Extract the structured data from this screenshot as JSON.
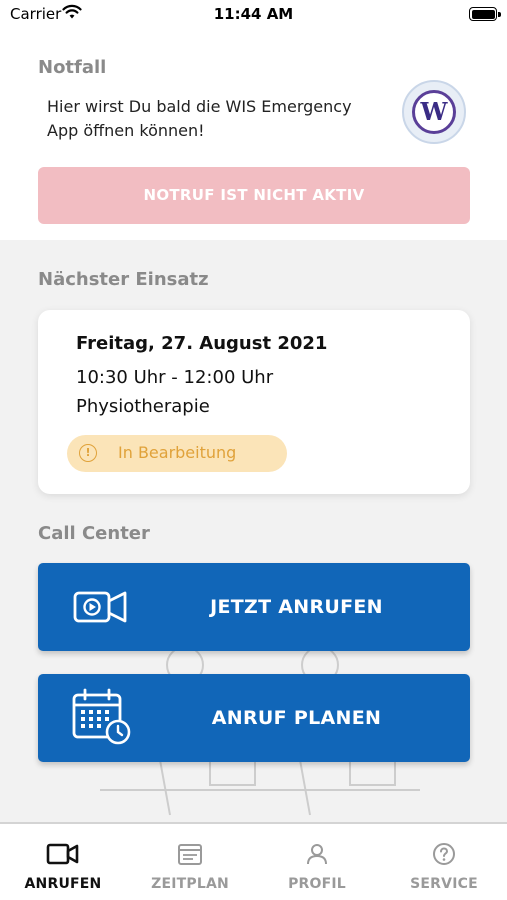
{
  "status_bar": {
    "carrier": "Carrier",
    "time": "11:44 AM",
    "battery_level": 1.0
  },
  "notfall": {
    "title": "Notfall",
    "text": "Hier wirst Du bald die WIS Emergency App öffnen können!",
    "logo_icon": "wis-emergency-logo",
    "notruf_label": "NOTRUF IST NICHT AKTIV"
  },
  "einsatz": {
    "title": "Nächster Einsatz",
    "date": "Freitag, 27. August 2021",
    "time": "10:30 Uhr - 12:00 Uhr",
    "type": "Physiotherapie",
    "status": "In Bearbeitung"
  },
  "callcenter": {
    "title": "Call Center",
    "call_now_label": "JETZT ANRUFEN",
    "call_now_icon": "video-camera-icon",
    "plan_call_label": "ANRUF PLANEN",
    "plan_call_icon": "calendar-clock-icon"
  },
  "tabs": [
    {
      "label": "ANRUFEN",
      "icon": "video-camera-icon",
      "active": true
    },
    {
      "label": "ZEITPLAN",
      "icon": "schedule-icon",
      "active": false
    },
    {
      "label": "PROFIL",
      "icon": "person-icon",
      "active": false
    },
    {
      "label": "SERVICE",
      "icon": "help-circle-icon",
      "active": false
    }
  ],
  "colors": {
    "primary_blue": "#1166b8",
    "notruf_inactive": "#f2bdc2",
    "status_chip_bg": "#fbe4b8",
    "status_chip_text": "#e0a23a",
    "section_title": "#8a8a8a"
  }
}
